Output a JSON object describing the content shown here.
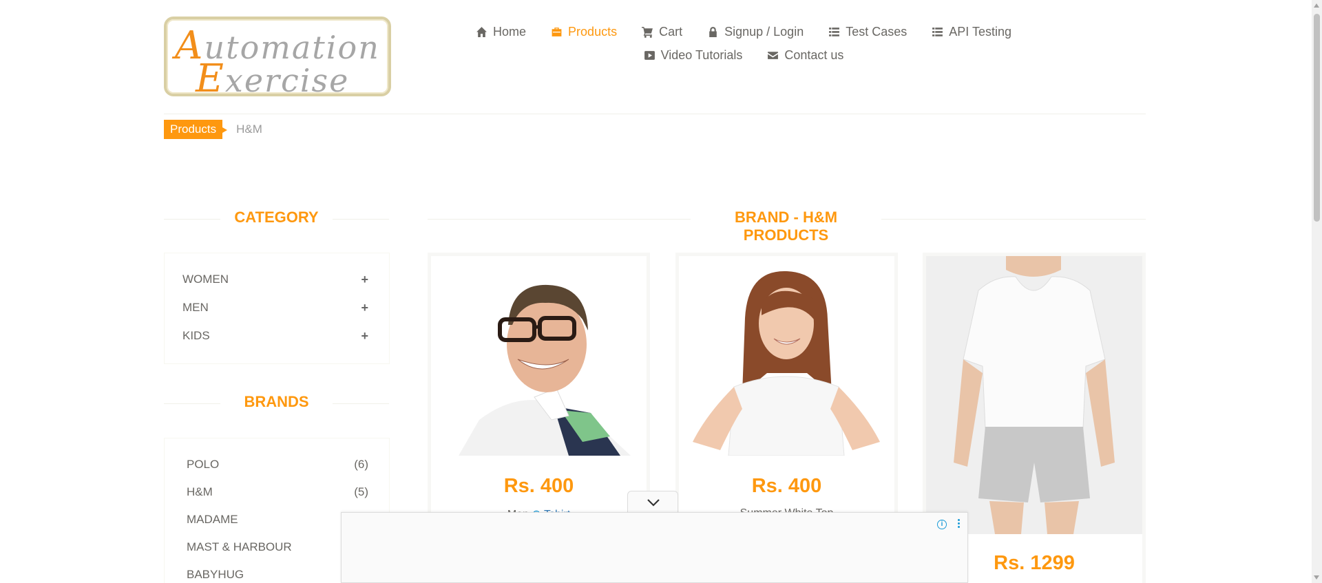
{
  "logo": {
    "line1_cap": "A",
    "line1_rest": "utomation",
    "line2_cap": "E",
    "line2_rest": "xercise"
  },
  "nav": {
    "items": [
      {
        "label": "Home",
        "icon": "home-icon"
      },
      {
        "label": "Products",
        "icon": "products-icon",
        "active": true
      },
      {
        "label": "Cart",
        "icon": "cart-icon"
      },
      {
        "label": "Signup / Login",
        "icon": "lock-icon"
      },
      {
        "label": "Test Cases",
        "icon": "list-icon"
      },
      {
        "label": "API Testing",
        "icon": "list-icon"
      },
      {
        "label": "Video Tutorials",
        "icon": "youtube-play-icon"
      },
      {
        "label": "Contact us",
        "icon": "envelope-icon"
      }
    ]
  },
  "breadcrumb": {
    "root": "Products",
    "current": "H&M"
  },
  "sidebar": {
    "category_title": "CATEGORY",
    "categories": [
      {
        "label": "WOMEN",
        "toggle": "+"
      },
      {
        "label": "MEN",
        "toggle": "+"
      },
      {
        "label": "KIDS",
        "toggle": "+"
      }
    ],
    "brands_title": "BRANDS",
    "brands": [
      {
        "label": "POLO",
        "count": "(6)"
      },
      {
        "label": "H&M",
        "count": "(5)"
      },
      {
        "label": "MADAME",
        "count": ""
      },
      {
        "label": "MAST & HARBOUR",
        "count": ""
      },
      {
        "label": "BABYHUG",
        "count": ""
      }
    ]
  },
  "main": {
    "title": "BRAND - H&M PRODUCTS",
    "products": [
      {
        "price": "Rs. 400",
        "name_prefix": "Men ",
        "name_link": "Tshirt"
      },
      {
        "price": "Rs. 400",
        "name": "Summer White Top"
      },
      {
        "price": "Rs. 1299"
      }
    ]
  },
  "colors": {
    "accent": "#FE980F",
    "text": "#696763",
    "ad_icon": "#1A9BD7"
  }
}
